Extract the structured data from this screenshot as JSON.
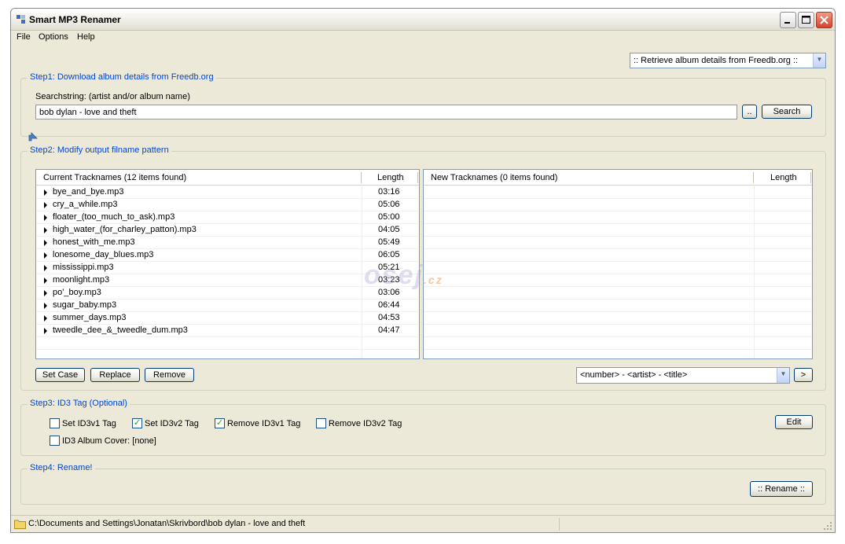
{
  "window": {
    "title": "Smart MP3 Renamer",
    "icons": {
      "app": "app-icon",
      "minimize": "minimize-icon",
      "maximize": "maximize-icon",
      "close": "close-icon"
    }
  },
  "menu": {
    "items": [
      "File",
      "Options",
      "Help"
    ]
  },
  "source_selector": {
    "value": ":: Retrieve album details from Freedb.org ::"
  },
  "step1": {
    "title": "Step1: Download album details from Freedb.org",
    "search_label": "Searchstring: (artist and/or album name)",
    "search_value": "bob dylan - love and theft",
    "browse_label": "..",
    "search_button": "Search"
  },
  "step2": {
    "title": "Step2: Modify output filname pattern",
    "current": {
      "header_name": "Current Tracknames (12 items found)",
      "header_length": "Length",
      "rows": [
        {
          "name": "bye_and_bye.mp3",
          "length": "03:16"
        },
        {
          "name": "cry_a_while.mp3",
          "length": "05:06"
        },
        {
          "name": "floater_(too_much_to_ask).mp3",
          "length": "05:00"
        },
        {
          "name": "high_water_(for_charley_patton).mp3",
          "length": "04:05"
        },
        {
          "name": "honest_with_me.mp3",
          "length": "05:49"
        },
        {
          "name": "lonesome_day_blues.mp3",
          "length": "06:05"
        },
        {
          "name": "mississippi.mp3",
          "length": "05:21"
        },
        {
          "name": "moonlight.mp3",
          "length": "03:23"
        },
        {
          "name": "po'_boy.mp3",
          "length": "03:06"
        },
        {
          "name": "sugar_baby.mp3",
          "length": "06:44"
        },
        {
          "name": "summer_days.mp3",
          "length": "04:53"
        },
        {
          "name": "tweedle_dee_&_tweedle_dum.mp3",
          "length": "04:47"
        }
      ]
    },
    "new": {
      "header_name": "New Tracknames (0 items found)",
      "header_length": "Length"
    },
    "buttons": {
      "set_case": "Set Case",
      "replace": "Replace",
      "remove": "Remove",
      "apply": ">"
    },
    "pattern_value": "<number> - <artist> - <title>"
  },
  "step3": {
    "title": "Step3: ID3 Tag (Optional)",
    "checks": [
      {
        "label": "Set ID3v1 Tag",
        "checked": false
      },
      {
        "label": "Set ID3v2 Tag",
        "checked": true
      },
      {
        "label": "Remove ID3v1 Tag",
        "checked": true
      },
      {
        "label": "Remove ID3v2 Tag",
        "checked": false
      }
    ],
    "album_cover": {
      "label": "ID3 Album Cover: [none]",
      "checked": false
    },
    "edit_button": "Edit"
  },
  "step4": {
    "title": "Step4: Rename!",
    "rename_button": ":: Rename ::"
  },
  "status": {
    "path": "C:\\Documents and Settings\\Jonatan\\Skrivbord\\bob dylan - love and theft"
  },
  "watermark": {
    "main": "osej",
    "suffix": ".cz"
  }
}
